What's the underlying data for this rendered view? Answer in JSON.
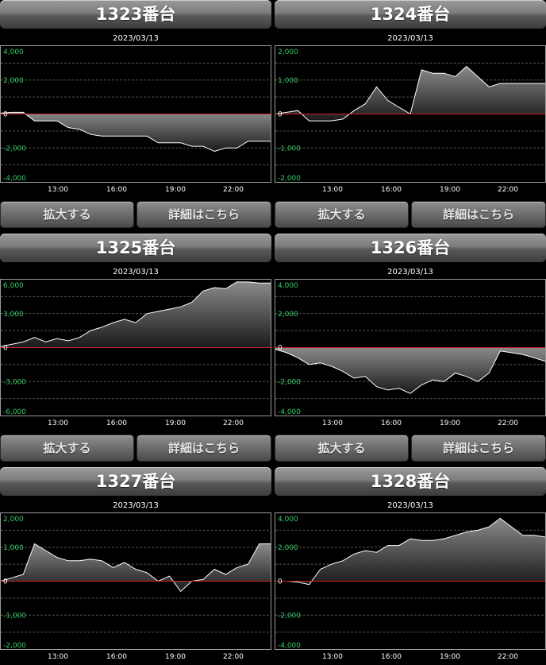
{
  "colors": {
    "positive_axis": "#33cc66",
    "negative_axis": "#33cc66",
    "zero_line": "#cc2222",
    "area_top": "#8a8a8a",
    "line": "#ffffff"
  },
  "buttons": {
    "zoom": "拡大する",
    "details": "詳細はこちら"
  },
  "machines": [
    {
      "title": "1323番台",
      "date": "2023/03/13",
      "chart_data": {
        "type": "area",
        "x_ticks": [
          "13:00",
          "16:00",
          "19:00",
          "22:00"
        ],
        "y_ticks": [
          "4,000",
          "2,000",
          "0",
          "-2,000",
          "-4,000"
        ],
        "ylim": [
          -4000,
          4000
        ],
        "x": [
          0,
          0.5,
          1,
          1.5,
          2,
          2.5,
          3,
          3.5,
          4,
          4.5,
          5,
          5.5,
          6,
          6.5,
          7,
          7.5,
          8,
          8.5,
          9,
          9.5,
          10,
          10.5,
          11,
          11.5,
          12
        ],
        "values": [
          50,
          100,
          100,
          -400,
          -400,
          -400,
          -800,
          -900,
          -1200,
          -1300,
          -1300,
          -1300,
          -1300,
          -1300,
          -1700,
          -1700,
          -1700,
          -1900,
          -1900,
          -2200,
          -2000,
          -2000,
          -1600,
          -1600,
          -1600
        ]
      }
    },
    {
      "title": "1324番台",
      "date": "2023/03/13",
      "chart_data": {
        "type": "area",
        "x_ticks": [
          "13:00",
          "16:00",
          "19:00",
          "22:00"
        ],
        "y_ticks": [
          "2,000",
          "1,000",
          "0",
          "-1,000",
          "-2,000"
        ],
        "ylim": [
          -2000,
          2000
        ],
        "x": [
          0,
          0.5,
          1,
          1.5,
          2,
          2.5,
          3,
          3.5,
          4,
          4.5,
          5,
          5.5,
          6,
          6.5,
          7,
          7.5,
          8,
          8.5,
          9,
          9.5,
          10,
          10.5,
          11,
          11.5,
          12
        ],
        "values": [
          0,
          50,
          100,
          -200,
          -200,
          -200,
          -150,
          100,
          300,
          800,
          400,
          200,
          0,
          1300,
          1200,
          1200,
          1100,
          1400,
          1100,
          800,
          900,
          900,
          900,
          900,
          900
        ]
      }
    },
    {
      "title": "1325番台",
      "date": "2023/03/13",
      "chart_data": {
        "type": "area",
        "x_ticks": [
          "13:00",
          "16:00",
          "19:00",
          "22:00"
        ],
        "y_ticks": [
          "6,000",
          "3,000",
          "0",
          "-3,000",
          "-6,000"
        ],
        "ylim": [
          -6000,
          6000
        ],
        "x": [
          0,
          0.5,
          1,
          1.5,
          2,
          2.5,
          3,
          3.5,
          4,
          4.5,
          5,
          5.5,
          6,
          6.5,
          7,
          7.5,
          8,
          8.5,
          9,
          9.5,
          10,
          10.5,
          11,
          11.5,
          12
        ],
        "values": [
          100,
          300,
          500,
          900,
          500,
          800,
          600,
          900,
          1500,
          1800,
          2200,
          2500,
          2200,
          3000,
          3200,
          3400,
          3600,
          4000,
          5000,
          5300,
          5200,
          5800,
          5800,
          5700,
          5700
        ]
      }
    },
    {
      "title": "1326番台",
      "date": "2023/03/13",
      "chart_data": {
        "type": "area",
        "x_ticks": [
          "13:00",
          "16:00",
          "19:00",
          "22:00"
        ],
        "y_ticks": [
          "4,000",
          "2,000",
          "0",
          "-2,000",
          "-4,000"
        ],
        "ylim": [
          -4000,
          4000
        ],
        "x": [
          0,
          0.5,
          1,
          1.5,
          2,
          2.5,
          3,
          3.5,
          4,
          4.5,
          5,
          5.5,
          6,
          6.5,
          7,
          7.5,
          8,
          8.5,
          9,
          9.5,
          10,
          10.5,
          11,
          11.5,
          12
        ],
        "values": [
          -100,
          -300,
          -600,
          -1000,
          -900,
          -1100,
          -1400,
          -1800,
          -1700,
          -2300,
          -2500,
          -2400,
          -2700,
          -2200,
          -1900,
          -2000,
          -1500,
          -1700,
          -2000,
          -1500,
          -200,
          -300,
          -400,
          -600,
          -800
        ]
      }
    },
    {
      "title": "1327番台",
      "date": "2023/03/13",
      "chart_data": {
        "type": "area",
        "x_ticks": [
          "13:00",
          "16:00",
          "19:00",
          "22:00"
        ],
        "y_ticks": [
          "2,000",
          "1,000",
          "0",
          "-1,000",
          "-2,000"
        ],
        "ylim": [
          -2000,
          2000
        ],
        "x": [
          0,
          0.5,
          1,
          1.5,
          2,
          2.5,
          3,
          3.5,
          4,
          4.5,
          5,
          5.5,
          6,
          6.5,
          7,
          7.5,
          8,
          8.5,
          9,
          9.5,
          10,
          10.5,
          11,
          11.5,
          12
        ],
        "values": [
          0,
          100,
          200,
          1100,
          900,
          700,
          600,
          600,
          650,
          600,
          400,
          550,
          350,
          250,
          0,
          150,
          -300,
          0,
          50,
          350,
          200,
          400,
          500,
          1100,
          1100
        ]
      }
    },
    {
      "title": "1328番台",
      "date": "2023/03/13",
      "chart_data": {
        "type": "area",
        "x_ticks": [
          "13:00",
          "16:00",
          "19:00",
          "22:00"
        ],
        "y_ticks": [
          "4,000",
          "2,000",
          "0",
          "-2,000",
          "-4,000"
        ],
        "ylim": [
          -4000,
          4000
        ],
        "x": [
          0,
          0.5,
          1,
          1.5,
          2,
          2.5,
          3,
          3.5,
          4,
          4.5,
          5,
          5.5,
          6,
          6.5,
          7,
          7.5,
          8,
          8.5,
          9,
          9.5,
          10,
          10.5,
          11,
          11.5,
          12
        ],
        "values": [
          0,
          0,
          -50,
          -200,
          700,
          1000,
          1200,
          1600,
          1800,
          1700,
          2100,
          2100,
          2500,
          2400,
          2400,
          2500,
          2700,
          2900,
          3000,
          3200,
          3700,
          3200,
          2700,
          2700,
          2600
        ]
      }
    }
  ]
}
